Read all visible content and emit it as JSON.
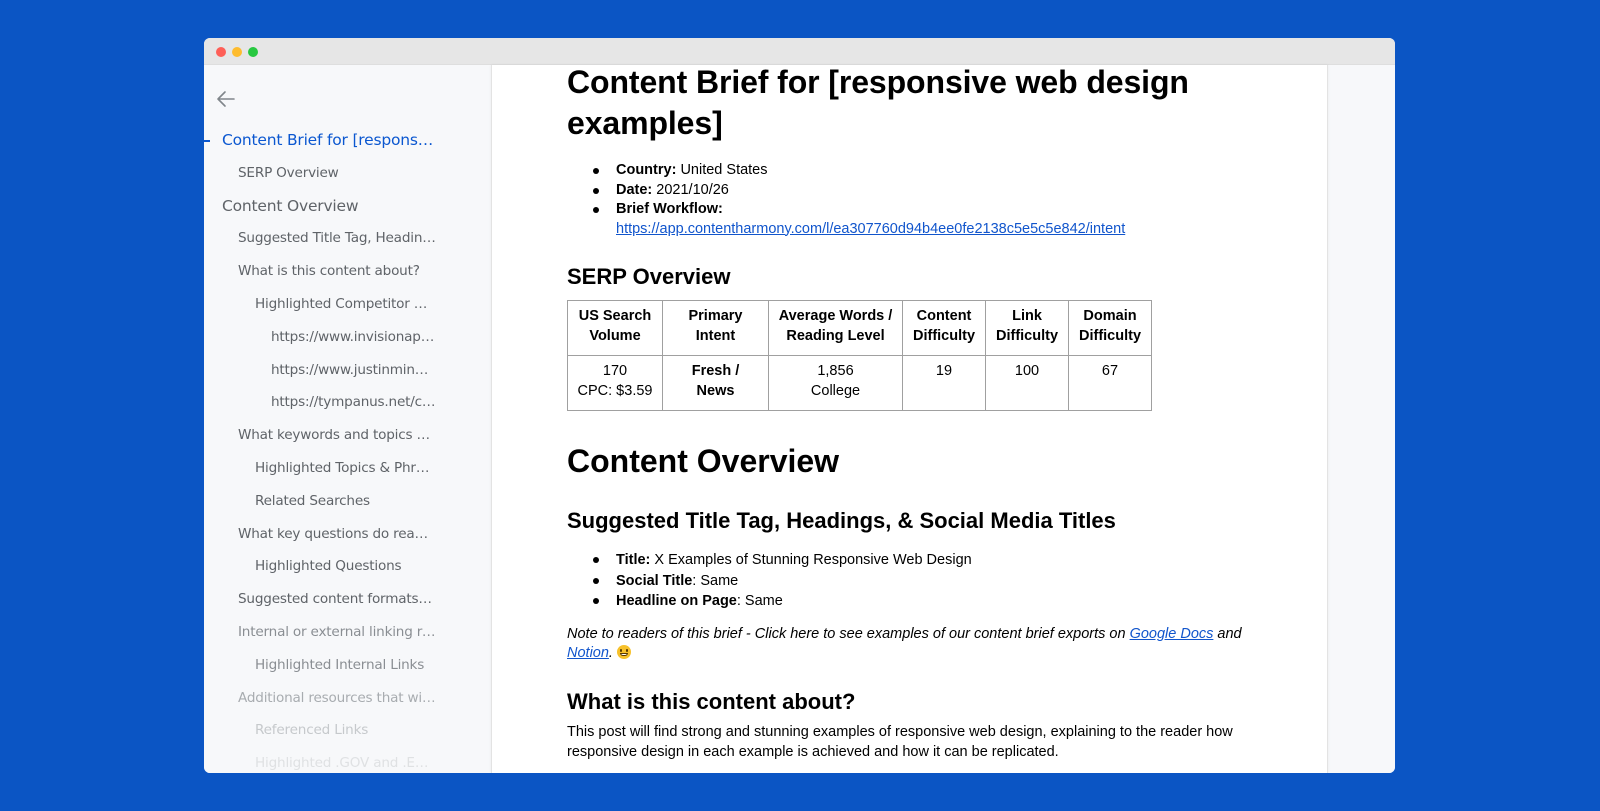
{
  "window": {
    "controls": [
      "close",
      "minimize",
      "maximize"
    ]
  },
  "sidebar": {
    "back_icon": "arrow-left-icon",
    "toc": [
      {
        "label": "Content Brief for [responsive web design examples]",
        "level": 1,
        "active": true
      },
      {
        "label": "SERP Overview",
        "level": 2
      },
      {
        "label": "Content Overview",
        "level": 1
      },
      {
        "label": "Suggested Title Tag, Headings, & Social Media Titles",
        "level": 2
      },
      {
        "label": "What is this content about?",
        "level": 2
      },
      {
        "label": "Highlighted Competitor Headings",
        "level": 3
      },
      {
        "label": "https://www.invisionapp.com/...",
        "level": 4
      },
      {
        "label": "https://www.justinmind.com/...",
        "level": 4
      },
      {
        "label": "https://tympanus.net/codrops/...",
        "level": 4
      },
      {
        "label": "What keywords and topics are important?",
        "level": 2
      },
      {
        "label": "Highlighted Topics & Phrases",
        "level": 3
      },
      {
        "label": "Related Searches",
        "level": 3
      },
      {
        "label": "What key questions do readers have?",
        "level": 2
      },
      {
        "label": "Highlighted Questions",
        "level": 3
      },
      {
        "label": "Suggested content formats or media",
        "level": 2
      },
      {
        "label": "Internal or external linking recommendations",
        "level": 2
      },
      {
        "label": "Highlighted Internal Links",
        "level": 3
      },
      {
        "label": "Additional resources that will help",
        "level": 2
      },
      {
        "label": "Referenced Links",
        "level": 3
      },
      {
        "label": "Highlighted .GOV and .EDU Links",
        "level": 3
      }
    ]
  },
  "doc": {
    "title": "Content Brief for [responsive web design examples]",
    "meta": {
      "country_label": "Country:",
      "country_value": " United States",
      "date_label": "Date:",
      "date_value": " 2021/10/26",
      "workflow_label": "Brief Workflow:",
      "workflow_url": "https://app.contentharmony.com/l/ea307760d94b4ee0fe2138c5e5c5e842/intent"
    },
    "serp": {
      "heading": "SERP Overview",
      "headers": [
        "US Search Volume",
        "Primary Intent",
        "Average Words / Reading Level",
        "Content Difficulty",
        "Link Difficulty",
        "Domain Difficulty"
      ],
      "row": {
        "volume": "170",
        "cpc": "CPC: $3.59",
        "intent_line1": "Fresh /",
        "intent_line2": "News",
        "words": "1,856",
        "reading_level": "College",
        "content_difficulty": "19",
        "link_difficulty": "100",
        "domain_difficulty": "67"
      }
    },
    "content_overview": {
      "heading": "Content Overview",
      "titles_heading": "Suggested Title Tag, Headings, & Social Media Titles",
      "titles": [
        {
          "label": "Title:",
          "value": " X Examples of Stunning Responsive Web Design"
        },
        {
          "label": "Social Title",
          "value": ": Same"
        },
        {
          "label": "Headline on Page",
          "value": ": Same"
        }
      ],
      "note": {
        "text": "Note to readers of this brief - Click here to see examples of our content brief exports on ",
        "link1": "Google Docs",
        "and": " and ",
        "link2": "Notion",
        "after": ". ",
        "emoji": "grinning-face-icon"
      },
      "about_heading": "What is this content about?",
      "about_body": "This post will find strong and stunning examples of responsive web design, explaining to the reader how responsive design in each example is achieved and how it can be replicated."
    }
  },
  "colors": {
    "background": "#0b55c4",
    "link": "#1155cc",
    "active_toc": "#0b57d0",
    "toc_text": "#5f6368"
  }
}
